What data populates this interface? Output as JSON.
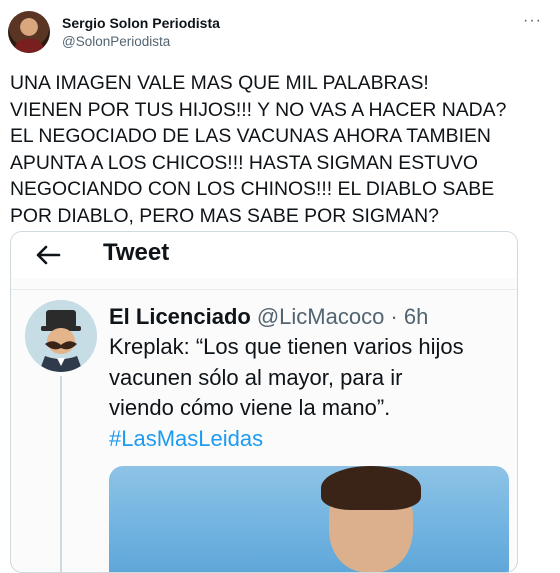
{
  "author": {
    "name": "Sergio Solon Periodista",
    "handle": "@SolonPeriodista",
    "more_label": "···"
  },
  "tweet_lines": [
    "UNA IMAGEN VALE MAS QUE MIL PALABRAS!",
    "VIENEN POR TUS HIJOS!!! Y NO VAS A HACER NADA?",
    "EL NEGOCIADO DE LAS VACUNAS AHORA TAMBIEN",
    "APUNTA A LOS CHICOS!!! HASTA SIGMAN ESTUVO",
    "NEGOCIANDO CON LOS CHINOS!!! EL DIABLO SABE",
    "POR DIABLO, PERO MAS SABE POR SIGMAN?"
  ],
  "quoted": {
    "header_title": "Tweet",
    "name": "El Licenciado",
    "handle_time": "@LicMacoco · 6h",
    "lines": [
      "Kreplak: “Los que tienen varios hijos",
      "vacunen sólo al mayor, para ir",
      "viendo cómo viene la mano”."
    ],
    "hashtag": "#LasMasLeidas"
  },
  "icons": {
    "back": "back-arrow-icon",
    "more": "more-horizontal-icon"
  }
}
